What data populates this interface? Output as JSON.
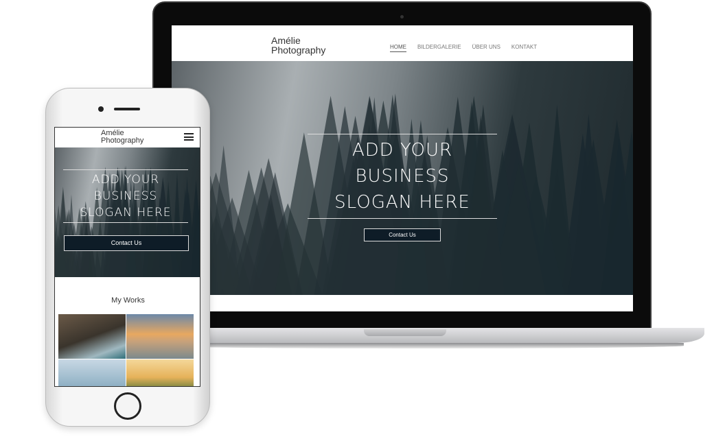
{
  "site": {
    "logo_line1": "Amélie",
    "logo_line2": "Photography",
    "nav": [
      {
        "label": "HOME",
        "active": true
      },
      {
        "label": "BILDERGALERIE"
      },
      {
        "label": "ÜBER UNS"
      },
      {
        "label": "KONTAKT"
      }
    ],
    "slogan": [
      "ADD YOUR",
      "BUSINESS",
      "SLOGAN HERE"
    ],
    "cta_label": "Contact Us",
    "works_title": "My Works",
    "accent_color": "#0e1c27"
  },
  "icons": {
    "menu": "hamburger-menu-icon"
  }
}
